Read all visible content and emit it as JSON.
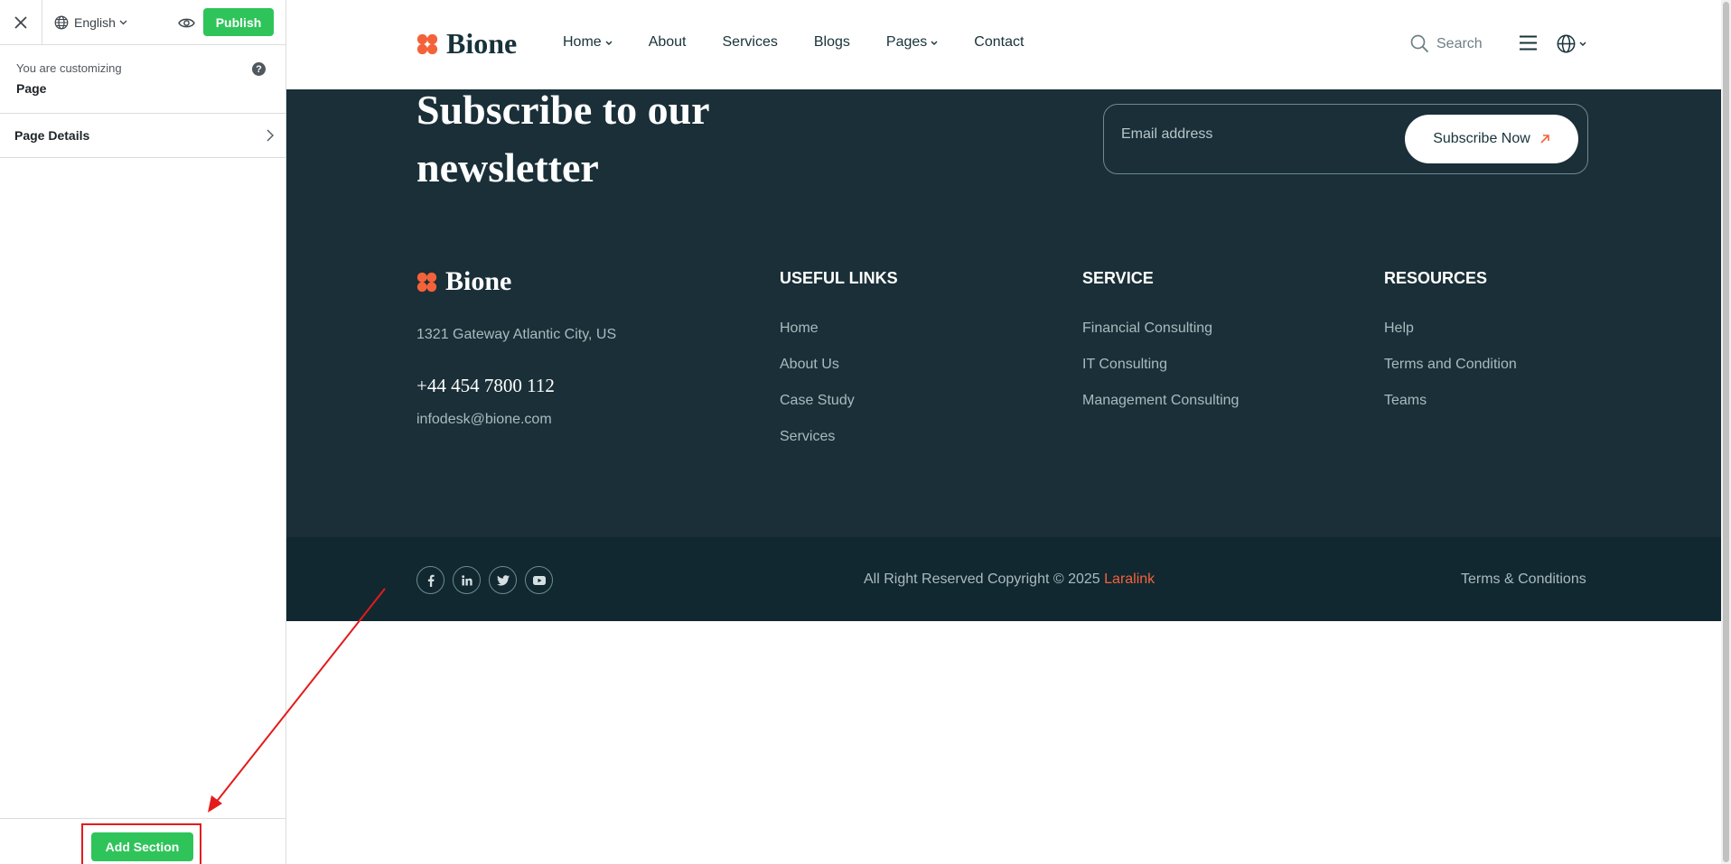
{
  "sidebar": {
    "language": "English",
    "publish_label": "Publish",
    "customizing_label": "You are customizing",
    "customizing_target": "Page",
    "help_glyph": "?",
    "page_details_label": "Page Details",
    "add_section_label": "Add Section"
  },
  "header": {
    "brand": "Bione",
    "nav": [
      "Home",
      "About",
      "Services",
      "Blogs",
      "Pages",
      "Contact"
    ],
    "search_label": "Search"
  },
  "newsletter": {
    "title": "Subscribe to our newsletter",
    "email_placeholder": "Email address",
    "button_label": "Subscribe Now"
  },
  "footer": {
    "brand": "Bione",
    "address": "1321 Gateway Atlantic City, US",
    "phone": "+44 454 7800 112",
    "email": "infodesk@bione.com",
    "columns": [
      {
        "title": "USEFUL LINKS",
        "links": [
          "Home",
          "About Us",
          "Case Study",
          "Services"
        ]
      },
      {
        "title": "SERVICE",
        "links": [
          "Financial Consulting",
          "IT Consulting",
          "Management Consulting"
        ]
      },
      {
        "title": "RESOURCES",
        "links": [
          "Help",
          "Terms and Condition",
          "Teams"
        ]
      }
    ],
    "copyright_text": "All Right Reserved Copyright © 2025 ",
    "copyright_brand": "Laralink",
    "terms_label": "Terms & Conditions"
  },
  "colors": {
    "publish_green": "#2fc45a",
    "footer_bg": "#1a2f37",
    "footer_bottom_bg": "#112830",
    "brand_orange": "#f4623a",
    "annotation_red": "#e41b1b"
  }
}
